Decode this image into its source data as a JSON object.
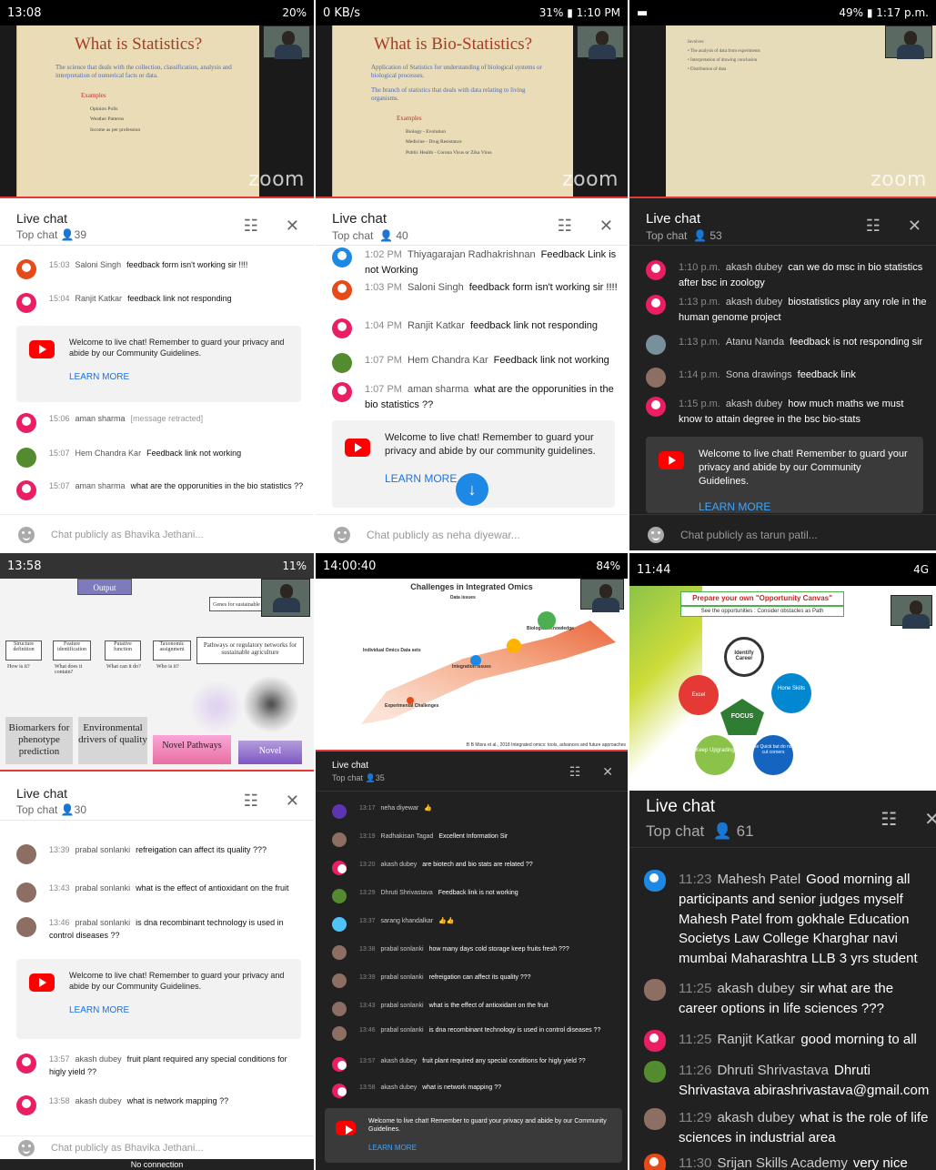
{
  "panels": {
    "p1": {
      "status_left": "13:08",
      "status_right": "20%",
      "slide_title": "What is Statistics?",
      "slide_sub": "The science that deals with the collection, classification, analysis and interpretation of numerical facts or data.",
      "slide_examples": "Examples",
      "slide_items": [
        "Opinion Polls",
        "Weather Patterns",
        "Income as per profession"
      ],
      "zoom": "zoom",
      "chat_title": "Live chat",
      "chat_sub": "Top chat",
      "viewers": "39",
      "messages": [
        {
          "time": "15:03",
          "author": "Saloni Singh",
          "text": "feedback form isn't working sir !!!!"
        },
        {
          "time": "15:04",
          "author": "Ranjit Katkar",
          "text": "feedback link not responding"
        },
        {
          "time": "15:06",
          "author": "aman sharma",
          "text": "[message retracted]"
        },
        {
          "time": "15:07",
          "author": "Hem Chandra Kar",
          "text": "Feedback link not working"
        },
        {
          "time": "15:07",
          "author": "aman sharma",
          "text": "what are the opporunities in the bio statistics ??"
        }
      ],
      "welcome": "Welcome to live chat! Remember to guard your privacy and abide by our Community Guidelines.",
      "learn_more": "LEARN MORE",
      "input_placeholder": "Chat publicly as Bhavika Jethani..."
    },
    "p2": {
      "status_left": "0 KB/s",
      "status_right": "31% ▮ 1:10 PM",
      "slide_title": "What is Bio-Statistics?",
      "slide_sub1": "Application of Statistics for understanding of biological systems or biological processes.",
      "slide_sub2": "The branch of statistics that deals with data relating to living organisms.",
      "slide_examples": "Examples",
      "slide_items": [
        "Biology - Evolution",
        "Medicine - Drug Resistance",
        "Public Health - Corona Virus or Zika Virus"
      ],
      "zoom": "zoom",
      "chat_title": "Live chat",
      "chat_sub": "Top chat",
      "viewers": "40",
      "messages": [
        {
          "time": "1:02 PM",
          "author": "Thiyagarajan Radhakrishnan",
          "text": "Feedback Link is not Working"
        },
        {
          "time": "1:03 PM",
          "author": "Saloni Singh",
          "text": "feedback form isn't working sir !!!!"
        },
        {
          "time": "1:04 PM",
          "author": "Ranjit Katkar",
          "text": "feedback link not responding"
        },
        {
          "time": "1:07 PM",
          "author": "Hem Chandra Kar",
          "text": "Feedback link not working"
        },
        {
          "time": "1:07 PM",
          "author": "aman sharma",
          "text": "what are the opporunities in the bio statistics ??"
        }
      ],
      "welcome": "Welcome to live chat! Remember to guard your privacy and abide by our community guidelines.",
      "learn_more": "LEARN MORE",
      "input_placeholder": "Chat publicly as neha diyewar..."
    },
    "p3": {
      "status_right": "49% ▮ 1:17 p.m.",
      "slide_lines": [
        "Involves:",
        "• The analysis of data from experiments",
        "• Interpretation of drawing conclusion",
        "• Distribution of data"
      ],
      "zoom": "zoom",
      "chat_title": "Live chat",
      "chat_sub": "Top chat",
      "viewers": "53",
      "messages": [
        {
          "time": "1:10 p.m.",
          "author": "akash dubey",
          "text": "can we do msc in bio statistics after bsc in zoology"
        },
        {
          "time": "1:13 p.m.",
          "author": "akash dubey",
          "text": "biostatistics play any role in the human genome project"
        },
        {
          "time": "1:13 p.m.",
          "author": "Atanu Nanda",
          "text": "feedback is not responding sir"
        },
        {
          "time": "1:14 p.m.",
          "author": "Sona drawings",
          "text": "feedback link"
        },
        {
          "time": "1:15 p.m.",
          "author": "akash dubey",
          "text": "how much maths we must know to attain degree in the bsc bio-stats"
        }
      ],
      "welcome": "Welcome to live chat! Remember to guard your privacy and abide by our Community Guidelines.",
      "learn_more": "LEARN MORE",
      "input_placeholder": "Chat publicly as tarun patil..."
    },
    "p4": {
      "status_left": "13:58",
      "status_right": "11%",
      "diagram": {
        "output": "Output",
        "genes": "Genes for sustainable",
        "boxes": [
          "Structure definition",
          "Feature identification",
          "Putative function",
          "Taxonomic assignment"
        ],
        "questions": [
          "How is it?",
          "What does it contain?",
          "What can it do?",
          "Who is it?"
        ],
        "pathways": "Pathways or regulatory networks for sustainable agriculture",
        "gray": [
          "Biomarkers for phenotype prediction",
          "Environmental drivers of quality"
        ],
        "novel1": "Novel Pathways",
        "novel2": "Novel"
      },
      "chat_title": "Live chat",
      "chat_sub": "Top chat",
      "viewers": "30",
      "messages": [
        {
          "time": "13:39",
          "author": "prabal sonlanki",
          "text": "refreigation can affect its quality ???"
        },
        {
          "time": "13:43",
          "author": "prabal sonlanki",
          "text": "what is the effect of antioxidant on the fruit"
        },
        {
          "time": "13:46",
          "author": "prabal sonlanki",
          "text": "is dna recombinant technology is used in control diseases ??"
        },
        {
          "time": "13:57",
          "author": "akash dubey",
          "text": "fruit plant required any special conditions for higly yield ??"
        },
        {
          "time": "13:58",
          "author": "akash dubey",
          "text": "what is network mapping ??"
        }
      ],
      "welcome": "Welcome to live chat! Remember to guard your privacy and abide by our Community Guidelines.",
      "learn_more": "LEARN MORE",
      "input_placeholder": "Chat publicly as Bhavika Jethani...",
      "no_connection": "No connection"
    },
    "p5": {
      "status_left": "14:00:40",
      "status_right": "84%",
      "slide_title": "Challenges in Integrated Omics",
      "labels": [
        "Data issues",
        "Individual Omics Data sets",
        "Integration Issues",
        "Biological Knowledge",
        "Experimental Challenges"
      ],
      "citation": "B B Misra et al., 2018 Integrated omics: tools, advances and future approaches",
      "chat_title": "Live chat",
      "chat_sub": "Top chat",
      "viewers": "35",
      "messages": [
        {
          "time": "13:17",
          "author": "neha diyewar",
          "text": "👍"
        },
        {
          "time": "13:19",
          "author": "Radhakisan Tagad",
          "text": "Excellent Information Sir"
        },
        {
          "time": "13:20",
          "author": "akash dubey",
          "text": "are biotech and bio stats are related ??"
        },
        {
          "time": "13:29",
          "author": "Dhruti Shrivastava",
          "text": "Feedback link is not working"
        },
        {
          "time": "13:37",
          "author": "sarang khandalkar",
          "text": "👍👍"
        },
        {
          "time": "13:38",
          "author": "prabal sonlanki",
          "text": "how many days cold storage keep fruits fresh ???"
        },
        {
          "time": "13:39",
          "author": "prabal sonlanki",
          "text": "refreigation can affect its quality ???"
        },
        {
          "time": "13:43",
          "author": "prabal sonlanki",
          "text": "what is the effect of antioxidant on the fruit"
        },
        {
          "time": "13:46",
          "author": "prabal sonlanki",
          "text": "is dna recombinant technology is used in control diseases ??"
        },
        {
          "time": "13:57",
          "author": "akash dubey",
          "text": "fruit plant required any special conditions for higly yield ??"
        },
        {
          "time": "13:58",
          "author": "akash dubey",
          "text": "what is network mapping ??"
        }
      ],
      "welcome": "Welcome to live chat! Remember to guard your privacy and abide by our Community Guidelines.",
      "learn_more": "LEARN MORE"
    },
    "p6": {
      "status_left": "11:44",
      "status_right": "4G",
      "slide_title": "Prepare your own \"Opportunity Canvas\"",
      "slide_sub": "See the opportunities : Consider obstacles as Path",
      "nodes": [
        "Identify Career",
        "Excel",
        "FOCUS",
        "Hone Skills",
        "Keep Upgrading",
        "Be Quick but do not cut corners"
      ],
      "zoom": "zoom",
      "chat_title": "Live chat",
      "chat_sub": "Top chat",
      "viewers": "61",
      "messages": [
        {
          "time": "11:23",
          "author": "Mahesh Patel",
          "text": "Good morning all participants and senior judges myself Mahesh Patel from gokhale Education Societys Law College Kharghar navi mumbai Maharashtra LLB 3 yrs student"
        },
        {
          "time": "11:25",
          "author": "akash dubey",
          "text": "sir what are the career options in life sciences ???"
        },
        {
          "time": "11:25",
          "author": "Ranjit Katkar",
          "text": "good morning to all"
        },
        {
          "time": "11:26",
          "author": "Dhruti Shrivastava",
          "text": "Dhruti Shrivastava abirashrivastava@gmail.com"
        },
        {
          "time": "11:29",
          "author": "akash dubey",
          "text": "what is the role of life sciences in industrial area"
        },
        {
          "time": "11:30",
          "author": "Srijan Skills Academy",
          "text": "very nice"
        }
      ]
    }
  }
}
